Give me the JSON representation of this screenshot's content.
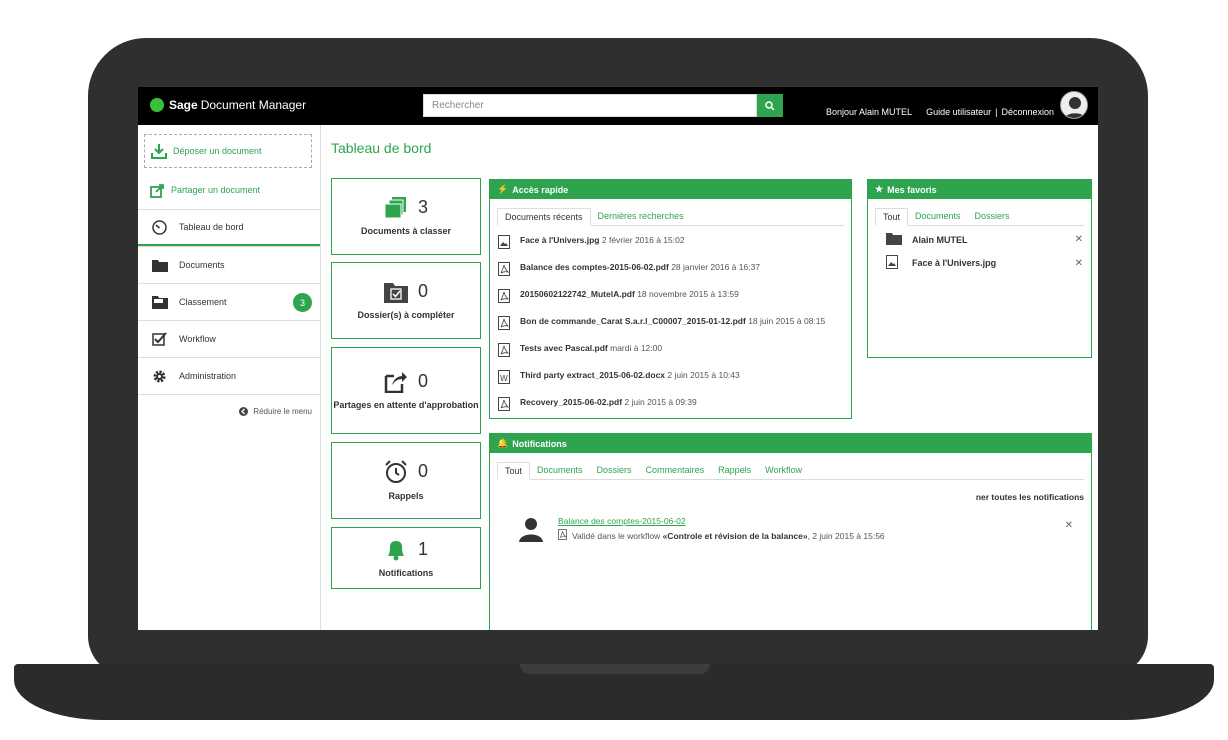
{
  "app": {
    "brand_bold": "Sage",
    "brand_rest": "Document Manager"
  },
  "search": {
    "placeholder": "Rechercher"
  },
  "user": {
    "greeting": "Bonjour Alain MUTEL",
    "guide": "Guide utilisateur",
    "separator": "|",
    "logout": "Déconnexion"
  },
  "sidebar": {
    "deposit": "Déposer un document",
    "share": "Partager un document",
    "items": [
      {
        "label": "Tableau de bord"
      },
      {
        "label": "Documents"
      },
      {
        "label": "Classement",
        "badge": "3"
      },
      {
        "label": "Workflow"
      },
      {
        "label": "Administration"
      }
    ],
    "reduce": "Réduire le menu"
  },
  "main": {
    "title": "Tableau de bord",
    "stats": [
      {
        "value": "3",
        "label": "Documents à classer"
      },
      {
        "value": "0",
        "label": "Dossier(s) à compléter"
      },
      {
        "value": "0",
        "label": "Partages en attente d'approbation"
      },
      {
        "value": "0",
        "label": "Rappels"
      },
      {
        "value": "1",
        "label": "Notifications"
      }
    ]
  },
  "quick_access": {
    "title": "Accès rapide",
    "tabs": [
      "Documents récents",
      "Dernières recherches"
    ],
    "items": [
      {
        "name": "Face à l'Univers.jpg",
        "date": "2 février 2016 à 15:02",
        "type": "image"
      },
      {
        "name": "Balance des comptes-2015-06-02.pdf",
        "date": "28 janvier 2016 à 16:37",
        "type": "pdf"
      },
      {
        "name": "20150602122742_MutelA.pdf",
        "date": "18 novembre 2015 à 13:59",
        "type": "pdf"
      },
      {
        "name": "Bon de commande_Carat S.a.r.l_C00007_2015-01-12.pdf",
        "date": "18 juin 2015 à 08:15",
        "type": "pdf"
      },
      {
        "name": "Tests avec Pascal.pdf",
        "date": "mardi à 12:00",
        "type": "pdf"
      },
      {
        "name": "Third party extract_2015-06-02.docx",
        "date": "2 juin 2015 à 10:43",
        "type": "word"
      },
      {
        "name": "Recovery_2015-06-02.pdf",
        "date": "2 juin 2015 à 09:39",
        "type": "pdf"
      }
    ]
  },
  "favorites": {
    "title": "Mes favoris",
    "tabs": [
      "Tout",
      "Documents",
      "Dossiers"
    ],
    "items": [
      {
        "name": "Alain MUTEL",
        "type": "folder"
      },
      {
        "name": "Face à l'Univers.jpg",
        "type": "image"
      }
    ]
  },
  "notifications": {
    "title": "Notifications",
    "tabs": [
      "Tout",
      "Documents",
      "Dossiers",
      "Commentaires",
      "Rappels",
      "Workflow"
    ],
    "mark_all": "ner toutes les notifications",
    "items": [
      {
        "title": "Balance des comptes-2015-06-02",
        "prefix": "Validé dans le workflow",
        "workflow": "«Controle et révision de la balance»",
        "date": ", 2 juin 2015 à 15:56"
      }
    ]
  },
  "colors": {
    "accent": "#2ea44f",
    "topbar": "#000000",
    "frame": "#2f2f2f"
  }
}
